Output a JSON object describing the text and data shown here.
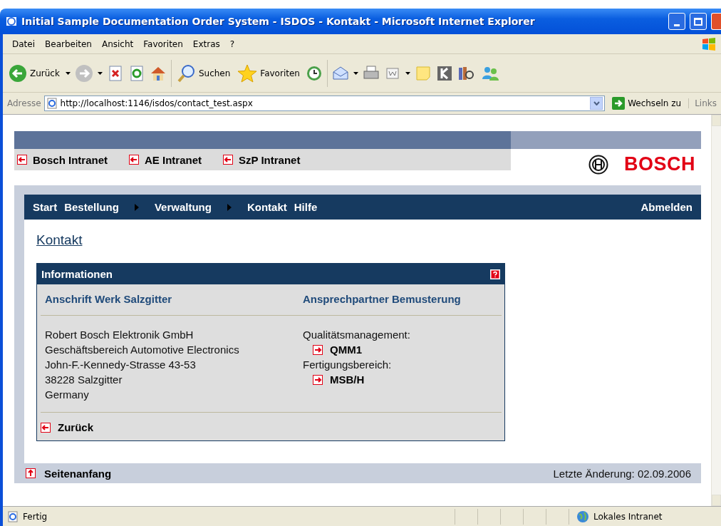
{
  "window": {
    "title": "Initial Sample Documentation Order System - ISDOS - Kontakt - Microsoft Internet Explorer"
  },
  "menu": [
    "Datei",
    "Bearbeiten",
    "Ansicht",
    "Favoriten",
    "Extras",
    "?"
  ],
  "toolbar": {
    "back": "Zurück",
    "search": "Suchen",
    "favorites": "Favoriten"
  },
  "address": {
    "label": "Adresse",
    "value": "http://localhost:1146/isdos/contact_test.aspx",
    "go": "Wechseln zu",
    "links": "Links"
  },
  "page": {
    "top_links": [
      "Bosch Intranet",
      "AE Intranet",
      "SzP Intranet"
    ],
    "logo": "BOSCH",
    "nav": [
      {
        "label": "Start",
        "submenu": false
      },
      {
        "label": "Bestellung",
        "submenu": true
      },
      {
        "label": "Verwaltung",
        "submenu": true
      },
      {
        "label": "Kontakt",
        "submenu": false
      },
      {
        "label": "Hilfe",
        "submenu": false
      }
    ],
    "logout": "Abmelden",
    "heading": "Kontakt",
    "panel": {
      "title": "Informationen",
      "left_heading": "Anschrift Werk Salzgitter",
      "right_heading": "Ansprechpartner Bemusterung",
      "address_lines": [
        "Robert Bosch Elektronik GmbH",
        "Geschäftsbereich Automotive Electronics",
        "John-F.-Kennedy-Strasse 43-53",
        "38228 Salzgitter",
        "Germany"
      ],
      "contacts": [
        {
          "label": "Qualitätsmanagement:",
          "link": "QMM1"
        },
        {
          "label": "Fertigungsbereich:",
          "link": "MSB/H"
        }
      ],
      "back": "Zurück"
    },
    "footer": {
      "top": "Seitenanfang",
      "updated": "Letzte Änderung: 02.09.2006"
    }
  },
  "status_bar": {
    "text": "Fertig",
    "zone": "Lokales Intranet"
  }
}
